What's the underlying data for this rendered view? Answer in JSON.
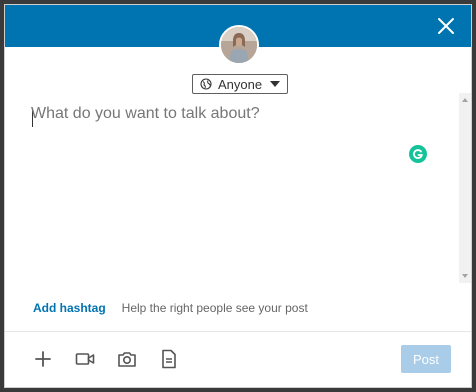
{
  "visibility": {
    "label": "Anyone",
    "icon": "globe-icon"
  },
  "editor": {
    "placeholder": "What do you want to talk about?"
  },
  "grammarly": {
    "letter": "G",
    "color": "#15c39a"
  },
  "hashtag": {
    "add_label": "Add hashtag",
    "help_text": "Help the right people see your post"
  },
  "toolbar": {
    "icons": [
      "plus-icon",
      "video-icon",
      "camera-icon",
      "document-icon"
    ]
  },
  "post_button": {
    "label": "Post"
  },
  "colors": {
    "header": "#0073b1",
    "accent": "#0073b1",
    "post_disabled": "#a9cde8"
  }
}
